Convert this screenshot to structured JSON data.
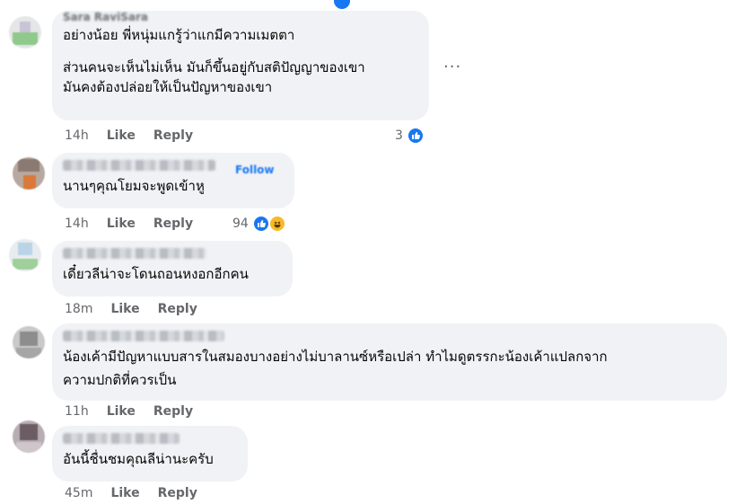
{
  "comments": [
    {
      "author": "Sara RaviSara",
      "lines": [
        "อย่างน้อย พี่หนุ่มแกรู้ว่าแกมีความเมตตา",
        "",
        "ส่วนคนจะเห็นไม่เห็น มันก็ขึ้นอยู่กับสติปัญญาของเขา",
        "มันคงต้องปล่อยให้เป็นปัญหาของเขา"
      ],
      "time": "14h",
      "like": "Like",
      "reply": "Reply",
      "reaction_count": "3",
      "reactions": [
        "like-icon"
      ]
    },
    {
      "author": "",
      "follow": "Follow",
      "lines": [
        "นานๆคุณโยมจะพูดเข้าหู"
      ],
      "time": "14h",
      "like": "Like",
      "reply": "Reply",
      "reaction_count": "94",
      "reactions": [
        "like-icon",
        "haha-icon"
      ]
    },
    {
      "author": "",
      "lines": [
        "เดี๋ยวลีน่าจะโดนถอนหงอกอีกคน"
      ],
      "time": "18m",
      "like": "Like",
      "reply": "Reply"
    },
    {
      "author": "",
      "lines": [
        "น้องเค้ามีปัญหาแบบสารในสมองบางอย่างไม่บาลานซ์หรือเปล่า ทำไมดูตรรกะน้องเค้าแปลกจาก",
        "ความปกติที่ควรเป็น"
      ],
      "time": "11h",
      "like": "Like",
      "reply": "Reply"
    },
    {
      "author": "",
      "lines": [
        "อันนี้ชื่นชมคุณลีน่านะครับ"
      ],
      "time": "45m",
      "like": "Like",
      "reply": "Reply"
    }
  ],
  "more_label": "···",
  "colors": {
    "accent": "#1877f2",
    "bubble": "#f0f2f5",
    "meta": "#65676b",
    "haha": "#f7b928"
  }
}
